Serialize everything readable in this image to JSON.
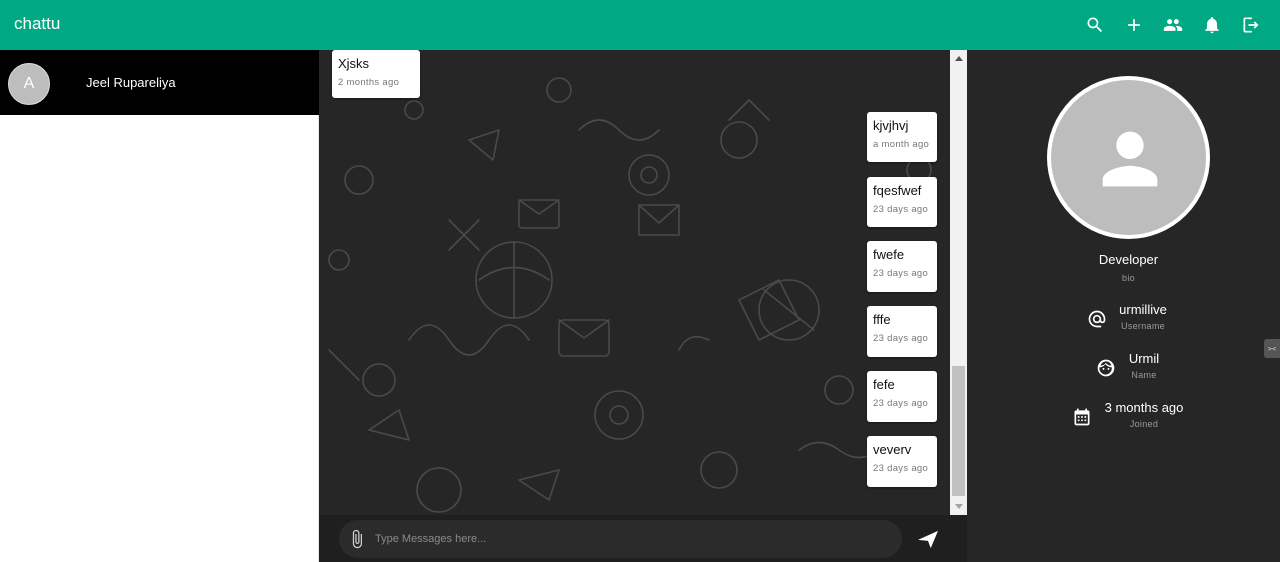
{
  "app": {
    "title": "chattu"
  },
  "colors": {
    "accent": "#00a884",
    "panel_dark": "#262626",
    "contact_bg": "#000000"
  },
  "toolbar": {
    "icons": [
      "search-icon",
      "add-icon",
      "group-icon",
      "notification-bell-icon",
      "logout-icon"
    ]
  },
  "contacts": [
    {
      "initial": "A",
      "name": "Jeel Rupareliya"
    }
  ],
  "messages": [
    {
      "text": "Xjsks",
      "time": "2 months ago",
      "side": "left"
    },
    {
      "text": "kjvjhvj",
      "time": "a month ago",
      "side": "right"
    },
    {
      "text": "fqesfwef",
      "time": "23 days ago",
      "side": "right"
    },
    {
      "text": "fwefe",
      "time": "23 days ago",
      "side": "right"
    },
    {
      "text": "fffe",
      "time": "23 days ago",
      "side": "right"
    },
    {
      "text": "fefe",
      "time": "23 days ago",
      "side": "right"
    },
    {
      "text": "veverv",
      "time": "23 days ago",
      "side": "right"
    }
  ],
  "composer": {
    "placeholder": "Type Messages here...",
    "value": ""
  },
  "profile": {
    "role": "Developer",
    "role_label": "bio",
    "username": "urmillive",
    "username_label": "Username",
    "name": "Urmil",
    "name_label": "Name",
    "joined": "3 months ago",
    "joined_label": "Joined"
  }
}
